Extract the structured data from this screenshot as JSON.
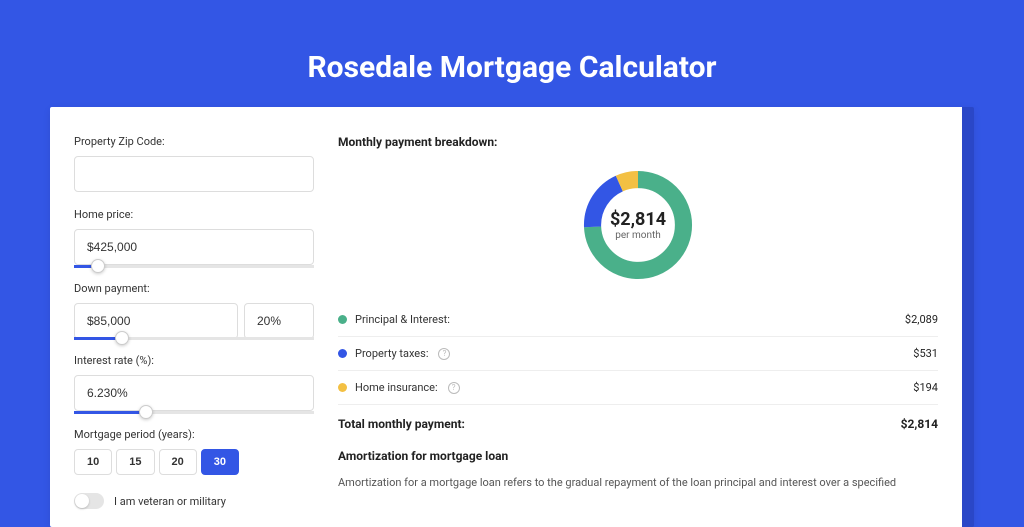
{
  "title": "Rosedale Mortgage Calculator",
  "form": {
    "zip": {
      "label": "Property Zip Code:",
      "value": ""
    },
    "homePrice": {
      "label": "Home price:",
      "value": "$425,000",
      "sliderPct": "10%"
    },
    "downPayment": {
      "label": "Down payment:",
      "amount": "$85,000",
      "pct": "20%",
      "sliderPct": "20%"
    },
    "interestRate": {
      "label": "Interest rate (%):",
      "value": "6.230%",
      "sliderPct": "30%"
    },
    "period": {
      "label": "Mortgage period (years):",
      "options": [
        "10",
        "15",
        "20",
        "30"
      ],
      "selected": "30"
    },
    "veteran": {
      "label": "I am veteran or military",
      "checked": false
    }
  },
  "breakdown": {
    "title": "Monthly payment breakdown:",
    "centerValue": "$2,814",
    "centerSub": "per month",
    "items": [
      {
        "name": "Principal & Interest:",
        "value": "$2,089",
        "color": "#4ab08a"
      },
      {
        "name": "Property taxes:",
        "value": "$531",
        "color": "#3356e5",
        "help": true
      },
      {
        "name": "Home insurance:",
        "value": "$194",
        "color": "#f3c043",
        "help": true
      }
    ],
    "totalLabel": "Total monthly payment:",
    "totalValue": "$2,814"
  },
  "amort": {
    "title": "Amortization for mortgage loan",
    "text": "Amortization for a mortgage loan refers to the gradual repayment of the loan principal and interest over a specified"
  },
  "chart_data": {
    "type": "pie",
    "title": "Monthly payment breakdown",
    "categories": [
      "Principal & Interest",
      "Property taxes",
      "Home insurance"
    ],
    "values": [
      2089,
      531,
      194
    ],
    "colors": [
      "#4ab08a",
      "#3356e5",
      "#f3c043"
    ],
    "total": 2814,
    "unit": "USD per month"
  }
}
